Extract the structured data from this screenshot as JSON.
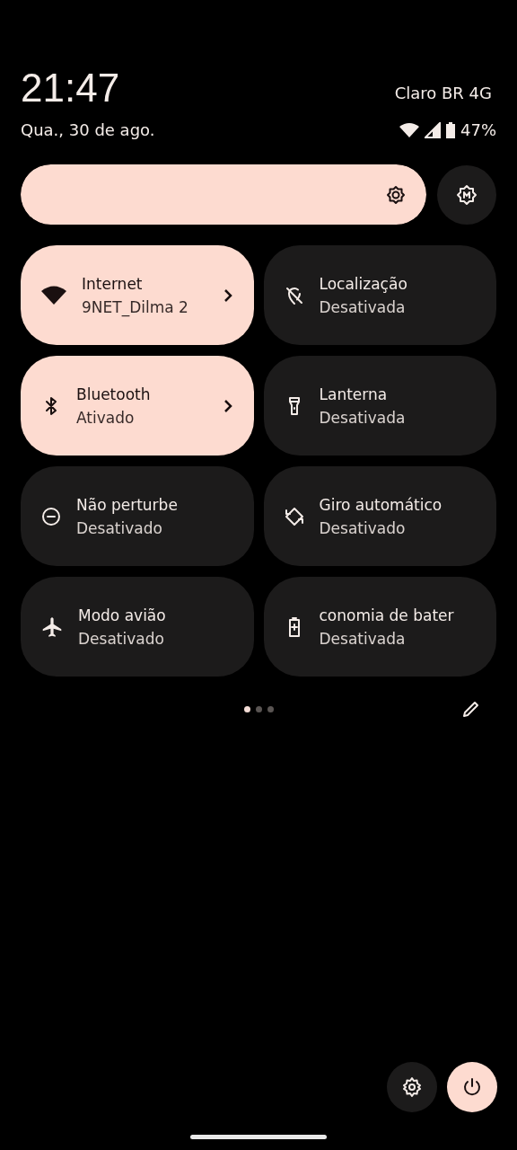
{
  "header": {
    "time": "21:47",
    "carrier": "Claro BR 4G",
    "date": "Qua., 30 de ago.",
    "battery": "47%"
  },
  "brightness": {
    "level": 1,
    "auto": false
  },
  "tiles": [
    {
      "title": "Internet",
      "subtitle": "9NET_Dilma 2",
      "on": true,
      "chevron": true
    },
    {
      "title": "Localização",
      "subtitle": "Desativada",
      "on": false,
      "chevron": false
    },
    {
      "title": "Bluetooth",
      "subtitle": "Ativado",
      "on": true,
      "chevron": true
    },
    {
      "title": "Lanterna",
      "subtitle": "Desativada",
      "on": false,
      "chevron": false
    },
    {
      "title": "Não perturbe",
      "subtitle": "Desativado",
      "on": false,
      "chevron": false
    },
    {
      "title": "Giro automático",
      "subtitle": "Desativado",
      "on": false,
      "chevron": false
    },
    {
      "title": "Modo avião",
      "subtitle": "Desativado",
      "on": false,
      "chevron": false
    },
    {
      "title": "conomia de bater",
      "subtitle": "Desativada",
      "on": false,
      "chevron": false
    }
  ],
  "pages": [
    {
      "selected": true
    },
    {
      "selected": false
    },
    {
      "selected": false
    }
  ]
}
